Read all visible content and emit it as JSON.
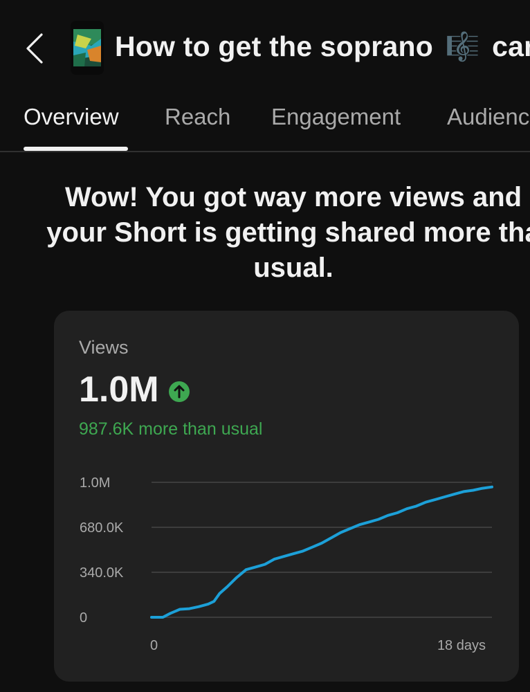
{
  "header": {
    "title_text": "How to get the soprano",
    "title_emoji": "🎼",
    "title_tail": "car"
  },
  "tabs": [
    {
      "label": "Overview",
      "active": true
    },
    {
      "label": "Reach",
      "active": false
    },
    {
      "label": "Engagement",
      "active": false
    },
    {
      "label": "Audienc",
      "active": false
    }
  ],
  "headline": {
    "line1": "Wow! You got way more views and",
    "line2": "your Short is getting shared more tha",
    "line3": "usual."
  },
  "card": {
    "label": "Views",
    "value": "1.0M",
    "trend_icon": "arrow-up-icon",
    "delta": "987.6K more than usual"
  },
  "colors": {
    "background": "#0f0f0f",
    "card": "#212121",
    "accent_line": "#1ca0d8",
    "positive": "#3ea851"
  },
  "chart_data": {
    "type": "line",
    "y_tick_labels": [
      "1.0M",
      "680.0K",
      "340.0K",
      "0"
    ],
    "x_tick_labels": [
      "0",
      "18 days"
    ],
    "ylim": [
      0,
      1020000
    ],
    "xlim": [
      0,
      18
    ],
    "grid": true,
    "series": [
      {
        "x": [
          0,
          0.6,
          1.0,
          1.5,
          2.0,
          2.5,
          3.0,
          3.3,
          3.6,
          4.0,
          4.5,
          5.0,
          5.5,
          6.0,
          6.5,
          7.0,
          7.5,
          8.0,
          8.5,
          9.0,
          9.5,
          10.0,
          10.5,
          11.0,
          11.5,
          12.0,
          12.5,
          13.0,
          13.5,
          14.0,
          14.5,
          15.0,
          15.5,
          16.0,
          16.5,
          17.0,
          17.5,
          18.0
        ],
        "y": [
          0,
          0,
          30000,
          60000,
          65000,
          80000,
          100000,
          120000,
          180000,
          230000,
          300000,
          360000,
          380000,
          400000,
          440000,
          460000,
          480000,
          500000,
          530000,
          560000,
          600000,
          640000,
          670000,
          700000,
          720000,
          740000,
          770000,
          790000,
          820000,
          840000,
          870000,
          890000,
          910000,
          930000,
          950000,
          960000,
          975000,
          985000
        ]
      }
    ]
  }
}
